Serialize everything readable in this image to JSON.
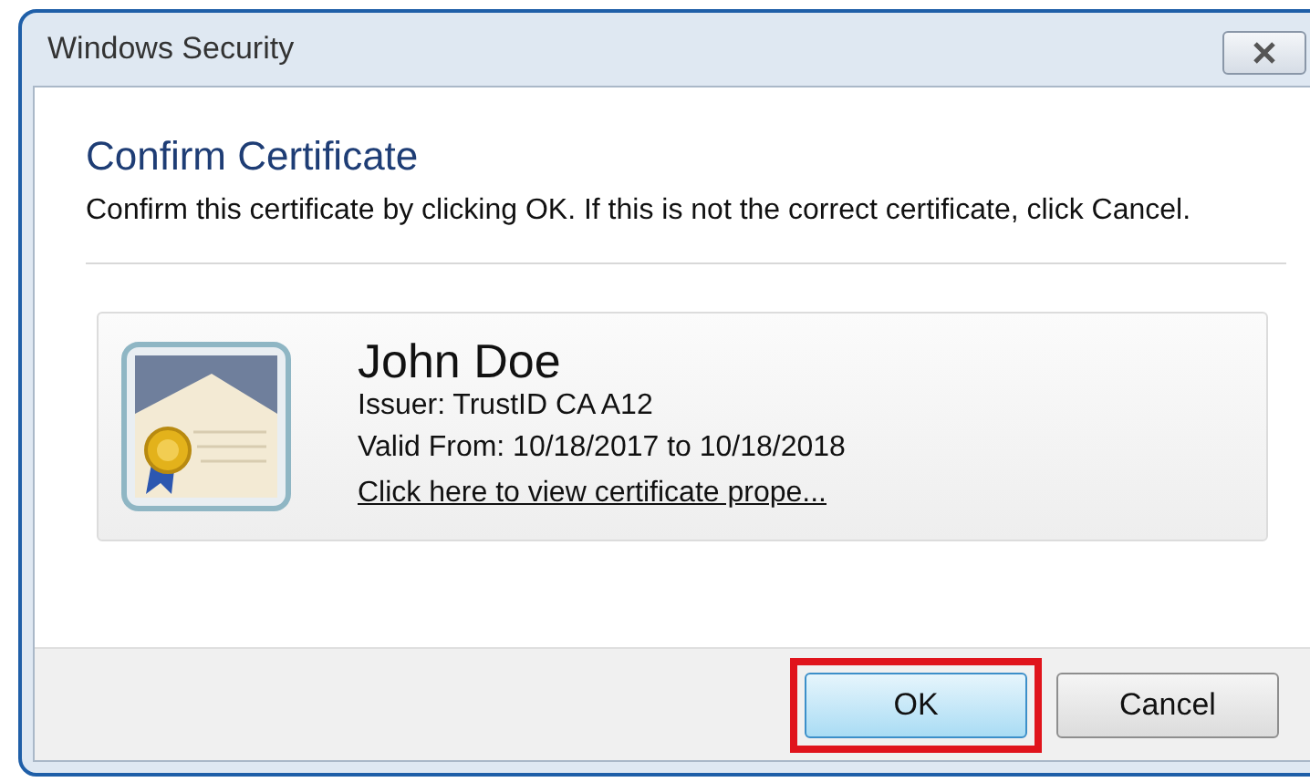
{
  "window": {
    "title": "Windows Security"
  },
  "heading": "Confirm Certificate",
  "message": "Confirm this certificate by clicking OK. If this is not the correct certificate, click Cancel.",
  "certificate": {
    "name": "John Doe",
    "issuer": "Issuer: TrustID CA A12",
    "validity": "Valid From: 10/18/2017 to 10/18/2018",
    "link": "Click here to view certificate prope..."
  },
  "buttons": [
    {
      "label": "OK",
      "default": true,
      "highlighted": true
    },
    {
      "label": "Cancel",
      "default": false,
      "highlighted": false
    }
  ]
}
